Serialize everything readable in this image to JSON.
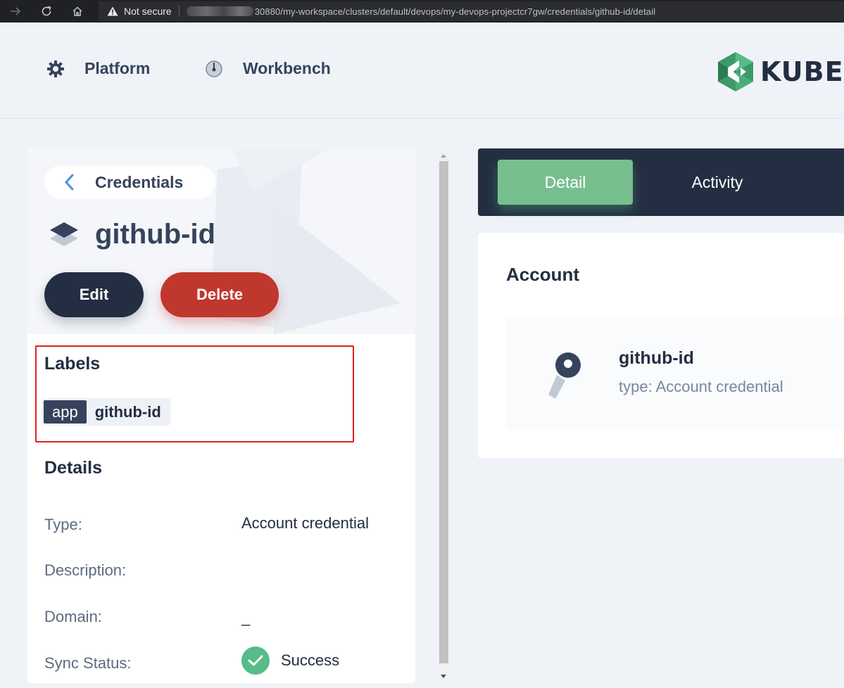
{
  "browser": {
    "security_label": "Not secure",
    "url": "30880/my-workspace/clusters/default/devops/my-devops-projectcr7gw/credentials/github-id/detail"
  },
  "header": {
    "nav": [
      {
        "label": "Platform",
        "icon": "gear-icon"
      },
      {
        "label": "Workbench",
        "icon": "dashboard-icon"
      }
    ],
    "logo_text": "KUBESP"
  },
  "left": {
    "back_label": "Credentials",
    "resource_name": "github-id",
    "edit_label": "Edit",
    "delete_label": "Delete",
    "labels_title": "Labels",
    "labels": [
      {
        "key": "app",
        "value": "github-id"
      }
    ],
    "details_title": "Details",
    "details": {
      "type_key": "Type:",
      "type_val": "Account credential",
      "description_key": "Description:",
      "description_val": "",
      "domain_key": "Domain:",
      "domain_val": "_",
      "sync_key": "Sync Status:",
      "sync_val": "Success"
    }
  },
  "tabs": {
    "detail_label": "Detail",
    "activity_label": "Activity"
  },
  "account": {
    "title": "Account",
    "cred_name": "github-id",
    "cred_type": "type: Account credential"
  },
  "colors": {
    "accent_green": "#55bc8a",
    "dark": "#242e42",
    "danger": "#ca2621",
    "highlight": "#e02020"
  }
}
